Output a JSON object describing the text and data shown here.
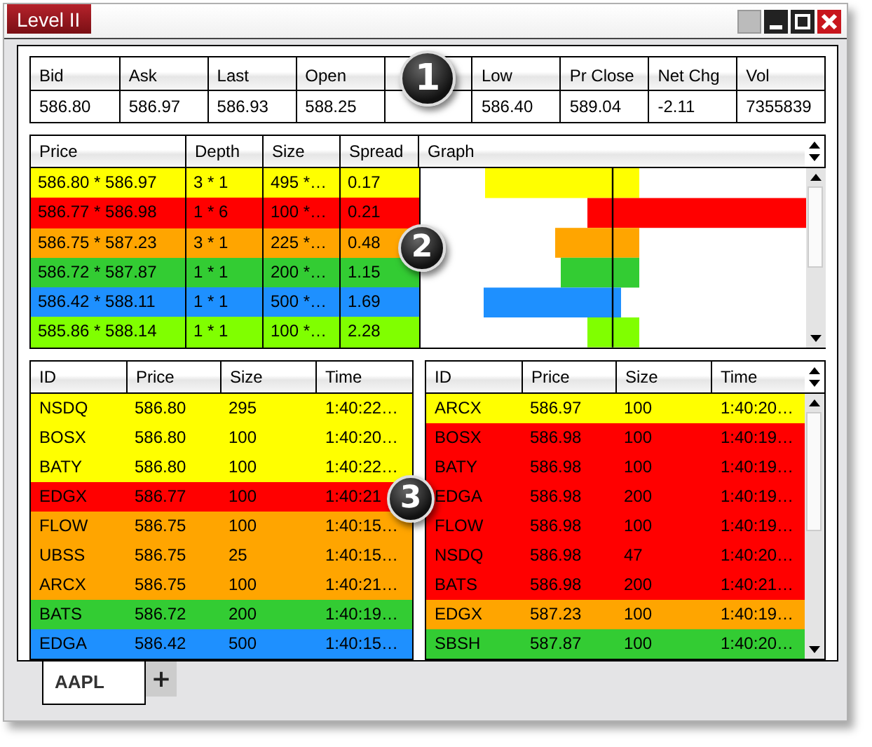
{
  "window": {
    "title": "Level II"
  },
  "quote": [
    {
      "label": "Bid",
      "value": "586.80"
    },
    {
      "label": "Ask",
      "value": "586.97"
    },
    {
      "label": "Last",
      "value": "586.93"
    },
    {
      "label": "Open",
      "value": "588.25"
    },
    {
      "callout": "1"
    },
    {
      "label": "Low",
      "value": "586.40"
    },
    {
      "label": "Pr Close",
      "value": "589.04"
    },
    {
      "label": "Net Chg",
      "value": "-2.11"
    },
    {
      "label": "Vol",
      "value": "7355839"
    }
  ],
  "book": {
    "columns": [
      "Price",
      "Depth",
      "Size",
      "Spread",
      "Graph"
    ],
    "rows": [
      {
        "price": "586.80 * 586.97",
        "depth": "3 * 1",
        "size": "495 *…",
        "spread": "0.17",
        "color": "#ffff00"
      },
      {
        "price": "586.77 * 586.98",
        "depth": "1 * 6",
        "size": "100 *…",
        "spread": "0.21",
        "color": "#ff0000"
      },
      {
        "price": "586.75 * 587.23",
        "depth": "3 * 1",
        "size": "225 *…",
        "spread": "0.48",
        "color": "#ffa500"
      },
      {
        "price": "586.72 * 587.87",
        "depth": "1 * 1",
        "size": "200 *…",
        "spread": "1.15",
        "color": "#33cc33"
      },
      {
        "price": "586.42 * 588.11",
        "depth": "1 * 1",
        "size": "500 *…",
        "spread": "1.69",
        "color": "#1e90ff"
      },
      {
        "price": "585.86 * 588.14",
        "depth": "1 * 1",
        "size": "100 *…",
        "spread": "2.28",
        "color": "#80ff00"
      }
    ]
  },
  "bids": {
    "columns": [
      "ID",
      "Price",
      "Size",
      "Time"
    ],
    "rows": [
      {
        "id": "NSDQ",
        "price": "586.80",
        "size": "295",
        "time": "1:40:22…",
        "color": "#ffff00"
      },
      {
        "id": "BOSX",
        "price": "586.80",
        "size": "100",
        "time": "1:40:20…",
        "color": "#ffff00"
      },
      {
        "id": "BATY",
        "price": "586.80",
        "size": "100",
        "time": "1:40:22…",
        "color": "#ffff00"
      },
      {
        "id": "EDGX",
        "price": "586.77",
        "size": "100",
        "time": "1:40:21",
        "color": "#ff0000"
      },
      {
        "id": "FLOW",
        "price": "586.75",
        "size": "100",
        "time": "1:40:15…",
        "color": "#ffa500"
      },
      {
        "id": "UBSS",
        "price": "586.75",
        "size": "25",
        "time": "1:40:15…",
        "color": "#ffa500"
      },
      {
        "id": "ARCX",
        "price": "586.75",
        "size": "100",
        "time": "1:40:21…",
        "color": "#ffa500"
      },
      {
        "id": "BATS",
        "price": "586.72",
        "size": "200",
        "time": "1:40:19…",
        "color": "#33cc33"
      },
      {
        "id": "EDGA",
        "price": "586.42",
        "size": "500",
        "time": "1:40:15…",
        "color": "#1e90ff"
      }
    ]
  },
  "asks": {
    "columns": [
      "ID",
      "Price",
      "Size",
      "Time"
    ],
    "rows": [
      {
        "id": "ARCX",
        "price": "586.97",
        "size": "100",
        "time": "1:40:20…",
        "color": "#ffff00"
      },
      {
        "id": "BOSX",
        "price": "586.98",
        "size": "100",
        "time": "1:40:19…",
        "color": "#ff0000"
      },
      {
        "id": "BATY",
        "price": "586.98",
        "size": "100",
        "time": "1:40:19…",
        "color": "#ff0000"
      },
      {
        "id": "EDGA",
        "price": "586.98",
        "size": "200",
        "time": "1:40:19…",
        "color": "#ff0000"
      },
      {
        "id": "FLOW",
        "price": "586.98",
        "size": "100",
        "time": "1:40:19…",
        "color": "#ff0000"
      },
      {
        "id": "NSDQ",
        "price": "586.98",
        "size": "47",
        "time": "1:40:20…",
        "color": "#ff0000"
      },
      {
        "id": "BATS",
        "price": "586.98",
        "size": "200",
        "time": "1:40:21…",
        "color": "#ff0000"
      },
      {
        "id": "EDGX",
        "price": "587.23",
        "size": "100",
        "time": "1:40:19…",
        "color": "#ffa500"
      },
      {
        "id": "SBSH",
        "price": "587.87",
        "size": "100",
        "time": "1:40:20…",
        "color": "#33cc33"
      }
    ]
  },
  "callouts": [
    "2",
    "3"
  ],
  "tabs": [
    {
      "label": "AAPL",
      "selected": true
    }
  ],
  "add_tab": "+"
}
